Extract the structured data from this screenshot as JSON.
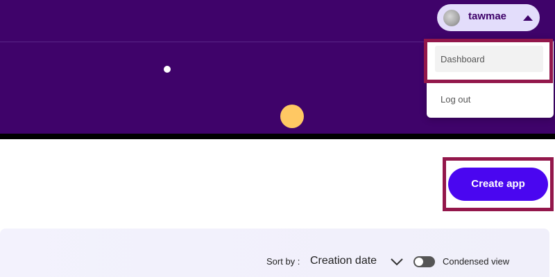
{
  "header": {
    "username": "tawmae",
    "avatar_icon": "user-avatar"
  },
  "user_menu": {
    "items": [
      {
        "label": "Dashboard"
      },
      {
        "label": "Log out"
      }
    ]
  },
  "actions": {
    "create_app_label": "Create app"
  },
  "list_controls": {
    "sort_by_label": "Sort by :",
    "sort_value": "Creation date",
    "condensed_view_label": "Condensed view",
    "condensed_view_enabled": false
  },
  "colors": {
    "header_bg": "#3f036a",
    "accent_button": "#4a06f0",
    "highlight_border": "#93174b"
  }
}
